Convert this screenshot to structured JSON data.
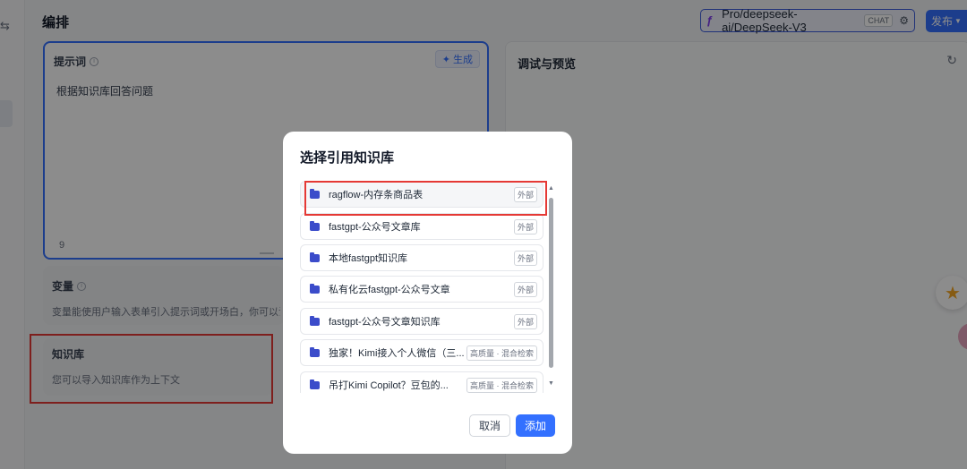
{
  "editor": {
    "title": "编排",
    "model_name": "Pro/deepseek-ai/DeepSeek-V3",
    "model_tag": "CHAT",
    "publish_label": "发布",
    "prompt": {
      "label": "提示词",
      "generate_label": "生成",
      "text": "根据知识库回答问题",
      "char_count": "9"
    },
    "variables": {
      "label": "变量",
      "description": "变量能使用户输入表单引入提示词或开场白，你可以试试在提"
    },
    "knowledge": {
      "label": "知识库",
      "description": "您可以导入知识库作为上下文"
    }
  },
  "preview": {
    "title": "调试与预览"
  },
  "modal": {
    "title": "选择引用知识库",
    "items": [
      {
        "name": "ragflow-内存条商品表",
        "tag": "外部"
      },
      {
        "name": "fastgpt-公众号文章库",
        "tag": "外部"
      },
      {
        "name": "本地fastgpt知识库",
        "tag": "外部"
      },
      {
        "name": "私有化云fastgpt-公众号文章",
        "tag": "外部"
      },
      {
        "name": "fastgpt-公众号文章知识库",
        "tag": "外部"
      },
      {
        "name": "独家！Kimi接入个人微信（三...",
        "tag": "高质量 · 混合检索"
      },
      {
        "name": "吊打Kimi Copilot？豆包的...",
        "tag": "高质量 · 混合检索"
      }
    ],
    "cancel_label": "取消",
    "add_label": "添加"
  },
  "colors": {
    "primary": "#3370ff",
    "highlight": "#e53935",
    "folder": "#3b4cca"
  }
}
